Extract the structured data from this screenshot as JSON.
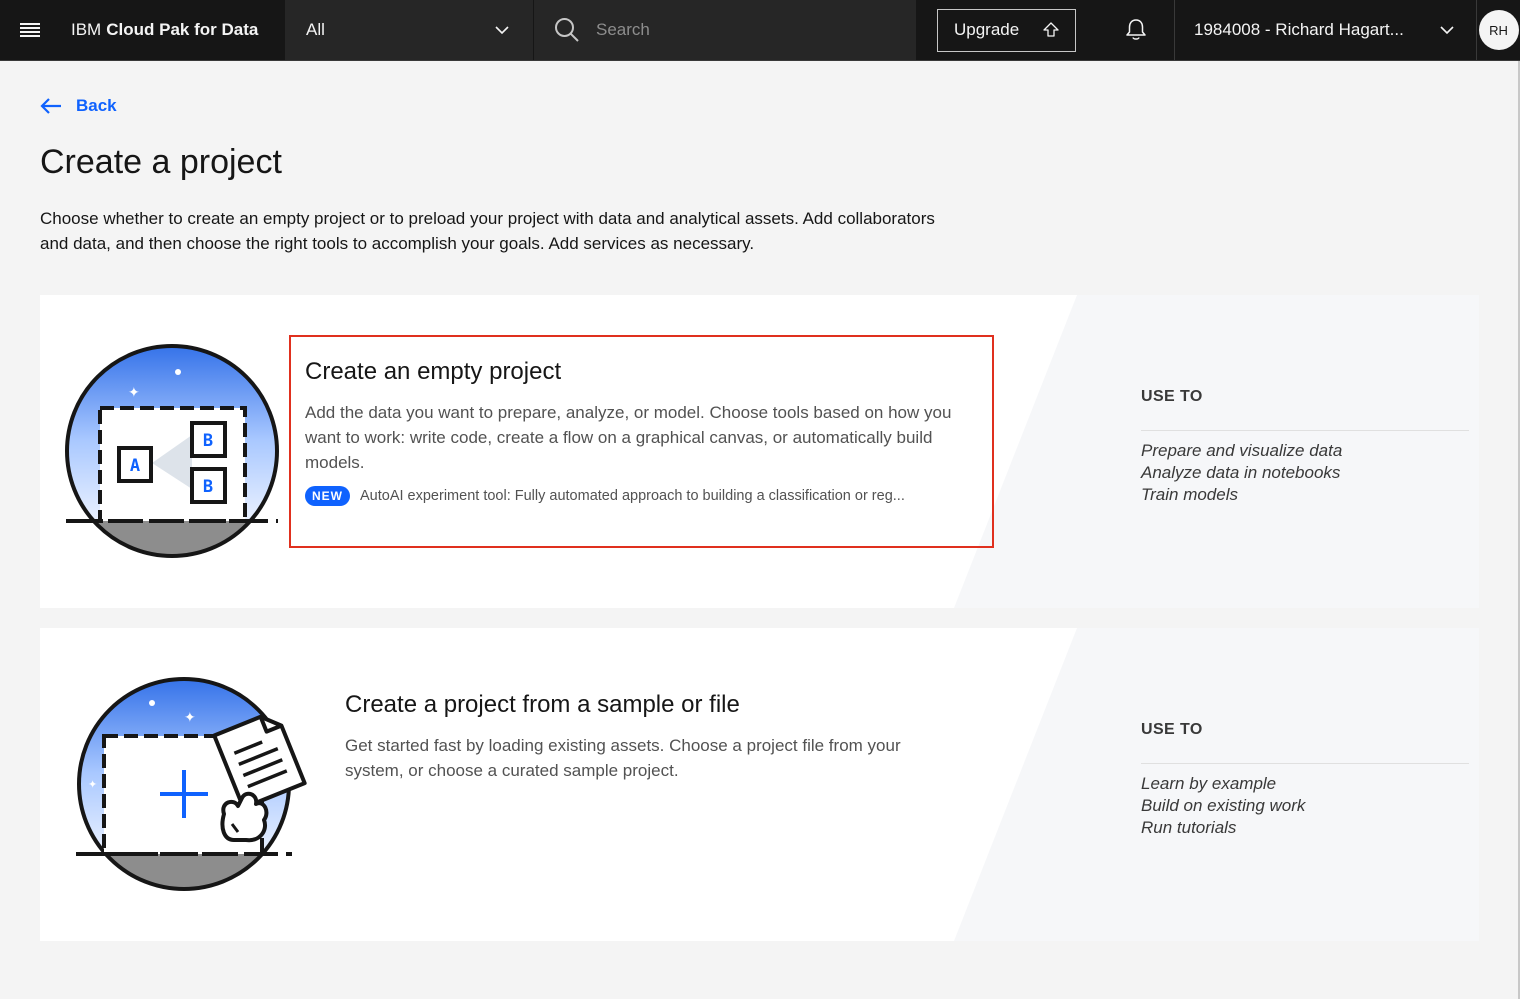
{
  "header": {
    "brand_prefix": "IBM",
    "brand_name": "Cloud Pak for Data",
    "scope_value": "All",
    "search_placeholder": "Search",
    "upgrade_label": "Upgrade",
    "account_label": "1984008 - Richard Hagart...",
    "avatar_initials": "RH"
  },
  "back_label": "Back",
  "page_title": "Create a project",
  "page_description": "Choose whether to create an empty project or to preload your project with data and analytical assets. Add collaborators and data, and then choose the right tools to accomplish your goals. Add services as necessary.",
  "cards": [
    {
      "title": "Create an empty project",
      "description": "Add the data you want to prepare, analyze, or model. Choose tools based on how you want to work: write code, create a flow on a graphical canvas, or automatically build models.",
      "badge": "NEW",
      "badge_text": "AutoAI experiment tool: Fully automated approach to building a classification or reg...",
      "use_to_heading": "USE TO",
      "use_to_items": [
        "Prepare and visualize data",
        "Analyze data in notebooks",
        "Train models"
      ],
      "illustration_letters": [
        "A",
        "B",
        "B"
      ]
    },
    {
      "title": "Create a project from a sample or file",
      "description": "Get started fast by loading existing assets. Choose a project file from your system, or choose a curated sample project.",
      "use_to_heading": "USE TO",
      "use_to_items": [
        "Learn by example",
        "Build on existing work",
        "Run tutorials"
      ]
    }
  ],
  "colors": {
    "header_bg": "#161616",
    "link_blue": "#0f62fe",
    "highlight_red": "#e0301e",
    "page_bg": "#f4f4f4"
  },
  "icons": [
    "menu-icon",
    "chevron-down-icon",
    "search-icon",
    "upgrade-arrow-icon",
    "notification-bell-icon",
    "arrow-left-icon"
  ]
}
